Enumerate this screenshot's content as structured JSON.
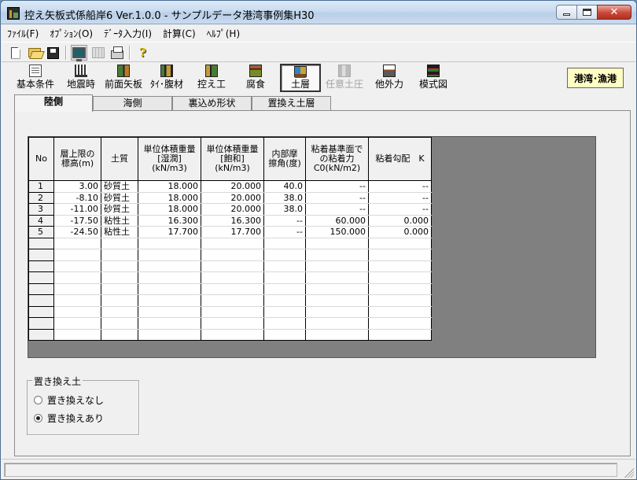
{
  "window": {
    "title": "控え矢板式係船岸6 Ver.1.0.0 - サンプルデータ港湾事例集H30"
  },
  "menu": [
    "ﾌｧｲﾙ(F)",
    "ｵﾌﾟｼｮﾝ(O)",
    "ﾃﾞｰﾀ入力(I)",
    "計算(C)",
    "ﾍﾙﾌﾟ(H)"
  ],
  "toolbar_icons": [
    "new-file-icon",
    "open-folder-icon",
    "save-icon",
    "monitor-icon",
    "table-icon",
    "print-icon",
    "help-icon"
  ],
  "buttons": [
    {
      "label": "基本条件",
      "icon": "basic-conditions-icon"
    },
    {
      "label": "地震時",
      "icon": "earthquake-icon"
    },
    {
      "label": "前面矢板",
      "icon": "front-sheet-pile-icon"
    },
    {
      "label": "ﾀｲ･腹材",
      "icon": "tie-rod-wale-icon"
    },
    {
      "label": "控え工",
      "icon": "anchor-work-icon"
    },
    {
      "label": "腐食",
      "icon": "corrosion-icon"
    },
    {
      "label": "土層",
      "icon": "soil-layer-icon",
      "active": true
    },
    {
      "label": "任意土圧",
      "icon": "earth-pressure-icon",
      "disabled": true
    },
    {
      "label": "他外力",
      "icon": "external-force-icon"
    },
    {
      "label": "模式図",
      "icon": "schematic-icon"
    }
  ],
  "mode_badge": "港湾･漁港",
  "tabs": [
    "陸側",
    "海側",
    "裏込め形状",
    "置換え土層"
  ],
  "active_tab": 0,
  "grid": {
    "headers": [
      "No",
      "層上限の\n標高(m)",
      "土質",
      "単位体積重量\n[湿潤]\n(kN/m3)",
      "単位体積重量\n[飽和]\n(kN/m3)",
      "内部摩\n擦角(度)",
      "粘着基準面で\nの粘着力\nC0(kN/m2)",
      "粘着勾配　K"
    ],
    "rows": [
      [
        "1",
        "3.00",
        "砂質土",
        "18.000",
        "20.000",
        "40.0",
        "--",
        "--"
      ],
      [
        "2",
        "-8.10",
        "砂質土",
        "18.000",
        "20.000",
        "38.0",
        "--",
        "--"
      ],
      [
        "3",
        "-11.00",
        "砂質土",
        "18.000",
        "20.000",
        "38.0",
        "--",
        "--"
      ],
      [
        "4",
        "-17.50",
        "粘性土",
        "16.300",
        "16.300",
        "--",
        "60.000",
        "0.000"
      ],
      [
        "5",
        "-24.50",
        "粘性土",
        "17.700",
        "17.700",
        "--",
        "150.000",
        "0.000"
      ],
      [
        "",
        "",
        "",
        "",
        "",
        "",
        "",
        ""
      ],
      [
        "",
        "",
        "",
        "",
        "",
        "",
        "",
        ""
      ],
      [
        "",
        "",
        "",
        "",
        "",
        "",
        "",
        ""
      ],
      [
        "",
        "",
        "",
        "",
        "",
        "",
        "",
        ""
      ],
      [
        "",
        "",
        "",
        "",
        "",
        "",
        "",
        ""
      ],
      [
        "",
        "",
        "",
        "",
        "",
        "",
        "",
        ""
      ],
      [
        "",
        "",
        "",
        "",
        "",
        "",
        "",
        ""
      ],
      [
        "",
        "",
        "",
        "",
        "",
        "",
        "",
        ""
      ],
      [
        "",
        "",
        "",
        "",
        "",
        "",
        "",
        ""
      ]
    ]
  },
  "replacement": {
    "title": "置き換え土",
    "options": [
      "置き換えなし",
      "置き換えあり"
    ],
    "selected": 1
  }
}
